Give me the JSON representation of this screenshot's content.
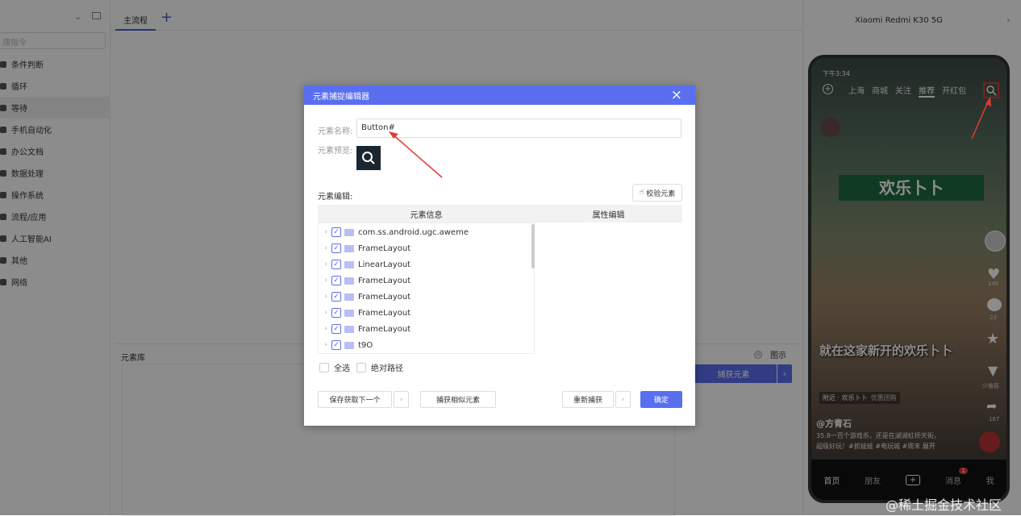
{
  "sidebar": {
    "search_placeholder": "搜指令",
    "items": [
      {
        "label": "条件判断"
      },
      {
        "label": "循环"
      },
      {
        "label": "等待"
      },
      {
        "label": "手机自动化"
      },
      {
        "label": "办公文档"
      },
      {
        "label": "数据处理"
      },
      {
        "label": "操作系统"
      },
      {
        "label": "流程/应用"
      },
      {
        "label": "人工智能AI"
      },
      {
        "label": "其他"
      },
      {
        "label": "网络"
      }
    ]
  },
  "tabs": {
    "main": "主流程",
    "add": "+"
  },
  "library": {
    "title": "元素库",
    "legend_icon": "⊖",
    "legend": "图示",
    "capture_button": "捕获元素",
    "capture_arrow": "›"
  },
  "phone": {
    "device_title": "Xiaomi Redmi K30 5G",
    "panel_arrow": "›",
    "status_time": "下午3:34",
    "top_tabs": [
      "上海",
      "商城",
      "关注",
      "推荐",
      "开红包"
    ],
    "banner": "欢乐卜卜",
    "caption": "就在这家新开的欢乐卜卜",
    "location": "附近 · 欢乐卜卜",
    "location_tag": "优惠团购",
    "author": "@方青石",
    "desc_line1": "35.8一百个游戏币，还是在湖湖虹桥天街，",
    "desc_line2": "超级好玩！#抓娃娃 #电玩城 #周末",
    "desc_more": "展开",
    "side_counts": [
      "148",
      "23",
      "",
      "少推荐",
      "167"
    ],
    "bottom_nav": [
      "首页",
      "朋友",
      "+",
      "消息",
      "我"
    ],
    "msg_badge": "1"
  },
  "modal": {
    "title": "元素捕捉编辑器",
    "close_icon": "×",
    "name_label": "元素名称:",
    "name_value": "Button#",
    "preview_label": "元素预览:",
    "edit_label": "元素编辑:",
    "verify_button": "校验元素",
    "col_info": "元素信息",
    "col_attr": "属性编辑",
    "tree": [
      {
        "label": "com.ss.android.ugc.aweme"
      },
      {
        "label": "FrameLayout"
      },
      {
        "label": "LinearLayout"
      },
      {
        "label": "FrameLayout"
      },
      {
        "label": "FrameLayout"
      },
      {
        "label": "FrameLayout"
      },
      {
        "label": "FrameLayout"
      },
      {
        "label": "t9O"
      }
    ],
    "select_all": "全选",
    "absolute_path": "绝对路径",
    "btn_save_next": "保存获取下一个",
    "btn_capture_similar": "捕获相似元素",
    "btn_recapture": "重新捕获",
    "btn_confirm": "确定"
  },
  "watermark": "@稀土掘金技术社区",
  "colors": {
    "accent": "#5a6ef0",
    "arrow": "#e53935"
  }
}
